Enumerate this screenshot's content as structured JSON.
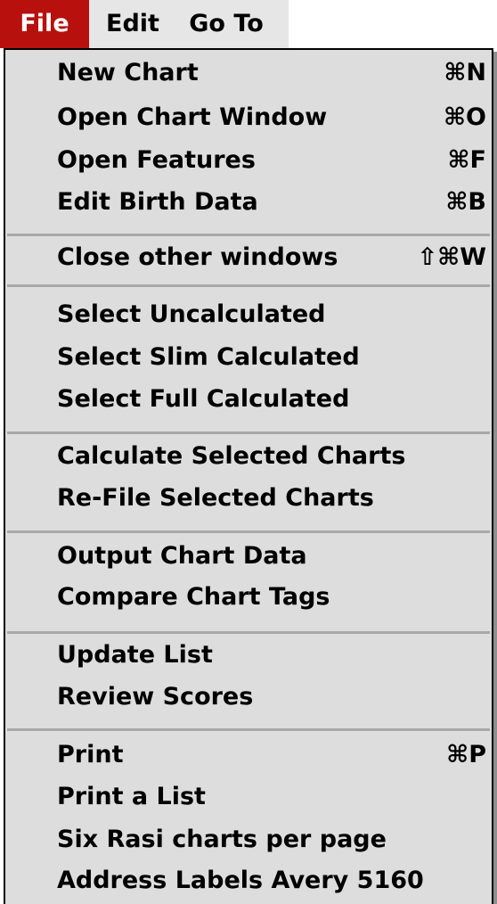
{
  "menubar": {
    "items": [
      {
        "label": "File",
        "active": true
      },
      {
        "label": "Edit",
        "active": false
      },
      {
        "label": "Go To",
        "active": false
      }
    ]
  },
  "menu": {
    "groups": [
      {
        "items": [
          {
            "label": "New Chart",
            "shortcut": "⌘N"
          },
          {
            "label": "Open Chart Window",
            "shortcut": "⌘O"
          },
          {
            "label": "Open Features",
            "shortcut": "⌘F"
          },
          {
            "label": "Edit Birth Data",
            "shortcut": "⌘B"
          }
        ]
      },
      {
        "items": [
          {
            "label": "Close other windows",
            "shortcut": "⇧⌘W"
          }
        ]
      },
      {
        "items": [
          {
            "label": "Select Uncalculated",
            "shortcut": ""
          },
          {
            "label": "Select Slim Calculated",
            "shortcut": ""
          },
          {
            "label": "Select Full Calculated",
            "shortcut": ""
          }
        ]
      },
      {
        "items": [
          {
            "label": "Calculate Selected Charts",
            "shortcut": ""
          },
          {
            "label": "Re-File Selected Charts",
            "shortcut": ""
          }
        ]
      },
      {
        "items": [
          {
            "label": "Output Chart Data",
            "shortcut": ""
          },
          {
            "label": "Compare Chart Tags",
            "shortcut": ""
          }
        ]
      },
      {
        "items": [
          {
            "label": "Update List",
            "shortcut": ""
          },
          {
            "label": "Review Scores",
            "shortcut": ""
          }
        ]
      },
      {
        "items": [
          {
            "label": "Print",
            "shortcut": "⌘P"
          },
          {
            "label": "Print a List",
            "shortcut": ""
          },
          {
            "label": "Six Rasi charts per page",
            "shortcut": ""
          },
          {
            "label": "Address Labels Avery 5160",
            "shortcut": ""
          }
        ]
      }
    ]
  },
  "colors": {
    "menubar_bg": "#e6e6e6",
    "menu_bg": "#dddddd",
    "active_title_bg": "#b8100c",
    "separator": "#a8a8a8"
  }
}
